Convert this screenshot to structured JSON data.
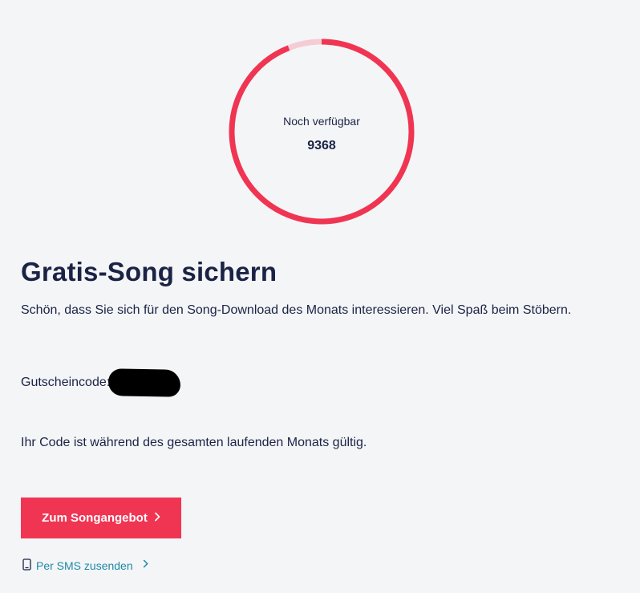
{
  "gauge": {
    "label": "Noch verfügbar",
    "value": "9368",
    "fraction": 0.94,
    "color_fill": "#f03553",
    "color_track": "#f6ccd4"
  },
  "header": {
    "title": "Gratis-Song sichern"
  },
  "content": {
    "intro": "Schön, dass Sie sich für den Song-Download des Monats interessieren. Viel Spaß beim Stöbern.",
    "voucher_label": "Gutscheincode:",
    "validity": "Ihr Code ist während des gesamten laufenden Monats gültig."
  },
  "actions": {
    "cta_label": "Zum Songangebot",
    "cta_color": "#f03553",
    "sms_label": "Per SMS zusenden",
    "sms_color": "#1d8aa6"
  },
  "icons": {
    "phone": "phone-icon",
    "chevron": "chevron-right-icon"
  }
}
